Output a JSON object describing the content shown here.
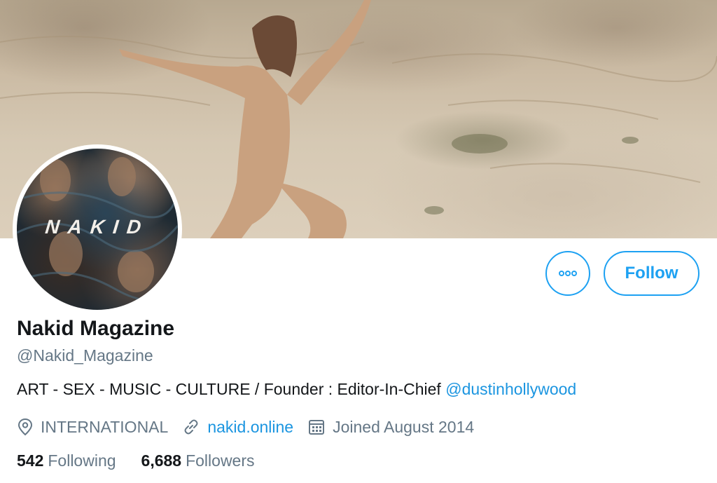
{
  "profile": {
    "display_name": "Nakid Magazine",
    "handle": "@Nakid_Magazine",
    "avatar_text": "NAKID",
    "bio": {
      "text": "ART - SEX - MUSIC - CULTURE / Founder : Editor-In-Chief ",
      "mention": "@dustinhollywood"
    },
    "location": "INTERNATIONAL",
    "website": "nakid.online",
    "joined": "Joined August 2014",
    "stats": {
      "following_count": "542",
      "following_label": "Following",
      "followers_count": "6,688",
      "followers_label": "Followers"
    }
  },
  "actions": {
    "follow_label": "Follow",
    "more_icon": "more-horizontal-icon"
  },
  "colors": {
    "accent": "#1da1f2",
    "link": "#1b95e0",
    "secondary_text": "#657786",
    "primary_text": "#14171a"
  }
}
